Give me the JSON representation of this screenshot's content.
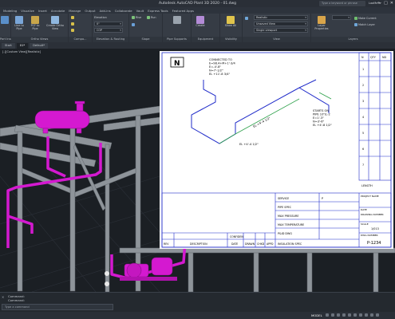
{
  "app": {
    "title": "Autodesk AutoCAD Plant 3D 2020 - 01.dwg",
    "search_placeholder": "Type a keyword or phrase",
    "user": "LaaMeTs",
    "window_controls": [
      "—",
      "□",
      "✕"
    ]
  },
  "menu_tabs": [
    "Modeling",
    "Visualize",
    "Insert",
    "Annotate",
    "Manage",
    "Output",
    "Add-ins",
    "Collaborate",
    "Vault",
    "Express Tools",
    "Featured Apps"
  ],
  "ribbon": {
    "panels": [
      {
        "label": "Part Insertion"
      },
      {
        "label": "Ortho Views"
      },
      {
        "label": "Compo..."
      },
      {
        "label": "Elevation & Routing"
      },
      {
        "label": "Slope"
      },
      {
        "label": "Pipe Supports"
      },
      {
        "label": "Equipment"
      },
      {
        "label": "Visibility"
      },
      {
        "label": "View"
      },
      {
        "label": "Layers"
      }
    ],
    "buttons": {
      "line_to_pipe": "Line to Pipe",
      "pcf_to_pipe": "PCF to Pipe",
      "create_ortho": "Create Ortho View",
      "rise": "Rise",
      "run": "Run",
      "create": "Create",
      "show_all": "Show All",
      "layer_properties": "Layer Properties",
      "make_current": "Make Current",
      "match_layer": "Match Layer"
    },
    "dropdowns": {
      "elevation_label": "Elevation",
      "elevation_value": "0\"",
      "cop": "COP",
      "visual_style": "Realistic",
      "view": "Unsaved View",
      "viewport": "Single viewport"
    }
  },
  "file_tabs": [
    "Start",
    "01*",
    "Default*"
  ],
  "viewport_label": "[-][Custom View][Realistic]",
  "iso": {
    "notes": [
      {
        "lines": [
          "CONNECTED TO",
          "E=98.4+M+1'-3/4",
          "E=-4'-8\"",
          "N=7'-1/2\"",
          "EL +11'-8 3/4\""
        ]
      },
      {
        "lines": [
          "STARTS ON",
          "PIPE 10\"/L-2",
          "E=1'-3\"",
          "N=3'-6\"",
          "EL +4'-8 1/2\""
        ]
      }
    ],
    "dims": [
      "EL +4'-4 1/2\"",
      "EL +4'-4 1/2\""
    ],
    "north": "N",
    "title_block": {
      "rows": [
        {
          "label": "SERVICE",
          "value": "P"
        },
        {
          "label": "PIPE SPEC",
          "value": ""
        },
        {
          "label": "MAX PRESSURE",
          "value": ""
        },
        {
          "label": "MAX TEMPERATURE",
          "value": ""
        },
        {
          "label": "P&ID DWG",
          "value": ""
        },
        {
          "label": "INSULATION SPEC",
          "value": ""
        }
      ],
      "rev_headers": [
        "REV",
        "DESCRIPTION",
        "DATE",
        "DRAWN",
        "CHKD",
        "APPD"
      ],
      "confidential": "CONFIDEN",
      "right_labels": [
        "PROJECT NAME",
        "DATE",
        "DRAWING NUMBER",
        "SCALE",
        "DWG NUMBER"
      ],
      "sheet": "1/013",
      "drawing_number": "P-1234"
    },
    "bom_headers": [
      "N",
      "QTY",
      "ND"
    ],
    "bom_rows": [
      {
        "n": "1",
        "qty": "",
        "nd": ""
      },
      {
        "n": "2",
        "qty": "",
        "nd": ""
      },
      {
        "n": "3",
        "qty": "",
        "nd": ""
      },
      {
        "n": "4",
        "qty": "",
        "nd": ""
      },
      {
        "n": "5",
        "qty": "",
        "nd": ""
      },
      {
        "n": "6",
        "qty": "",
        "nd": ""
      },
      {
        "n": "7",
        "qty": "",
        "nd": ""
      }
    ],
    "length_header": "LENGTH"
  },
  "command": {
    "history": [
      "Command:",
      "Command:"
    ],
    "placeholder": "Type a command"
  },
  "status": {
    "model": "MODEL"
  },
  "colors": {
    "pipe": "#d419d0",
    "steel": "#8e949a",
    "ribbon_bg": "#363c45",
    "iso_line": "#1f2bc9",
    "dim_green": "#2ea14b"
  }
}
